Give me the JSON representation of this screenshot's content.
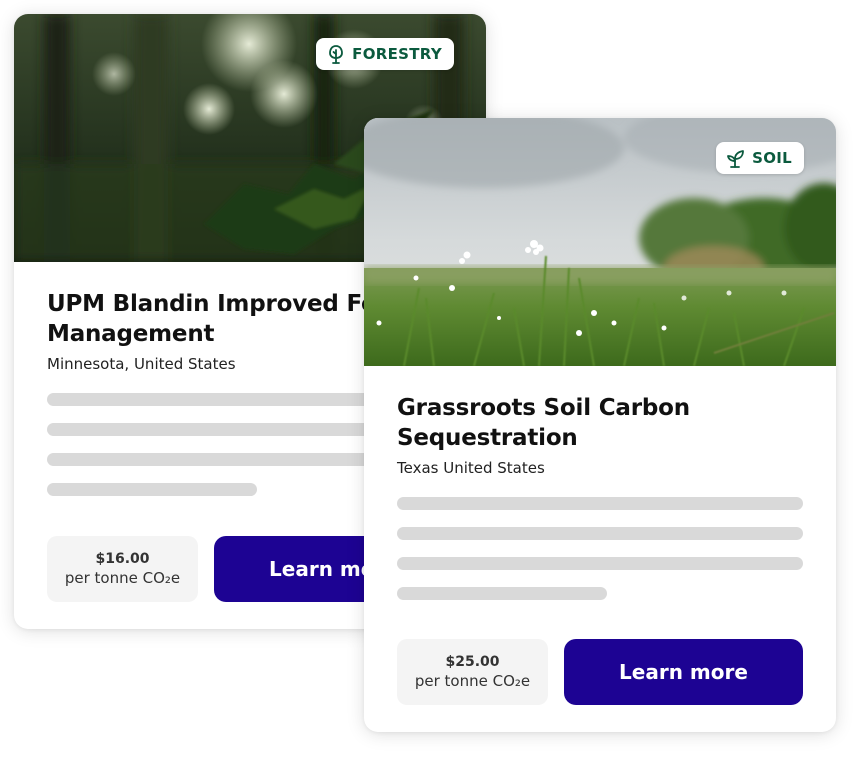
{
  "cards": [
    {
      "category": "FORESTRY",
      "category_icon": "tree-icon",
      "title_line1": "UPM Blandin Improved Forest",
      "title_line2": "Management",
      "location": "Minnesota, United States",
      "price": "$16.00",
      "price_unit": "per tonne CO₂e",
      "button_label": "Learn more"
    },
    {
      "category": "SOIL",
      "category_icon": "sprout-icon",
      "title_line1": "Grassroots Soil Carbon",
      "title_line2": "Sequestration",
      "location": "Texas United States",
      "price": "$25.00",
      "price_unit": "per tonne CO₂e",
      "button_label": "Learn more"
    }
  ],
  "colors": {
    "button": "#1d0393",
    "tag_text": "#0b5a3e",
    "skeleton": "#d9d9d9",
    "price_bg": "#f4f4f4"
  }
}
